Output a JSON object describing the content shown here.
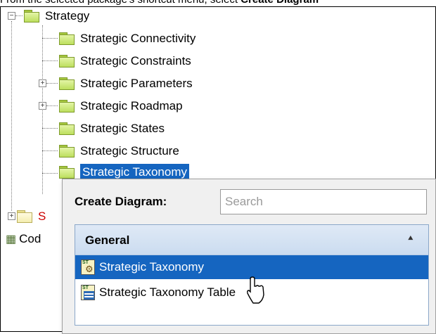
{
  "caption": {
    "text_before": "From the selected package's shortcut menu, select ",
    "text_bold": "Create Diagram"
  },
  "tree": {
    "root": {
      "label": "Strategy",
      "expander": "minus"
    },
    "items": [
      {
        "label": "Strategic Connectivity",
        "expander": ""
      },
      {
        "label": "Strategic Constraints",
        "expander": ""
      },
      {
        "label": "Strategic Parameters",
        "expander": "plus"
      },
      {
        "label": "Strategic Roadmap",
        "expander": "plus"
      },
      {
        "label": "Strategic States",
        "expander": ""
      },
      {
        "label": "Strategic Structure",
        "expander": ""
      },
      {
        "label": "Strategic Taxonomy",
        "expander": "",
        "selected": true
      }
    ],
    "partial_sibling": {
      "label": "S",
      "expander": "plus"
    },
    "code_item": {
      "label": "Cod",
      "icon": "code-engineering-icon"
    }
  },
  "popup": {
    "title": "Create Diagram:",
    "search_placeholder": "Search",
    "group": {
      "label": "General",
      "collapse_icon": "double-chevron-up-icon"
    },
    "items": [
      {
        "label": "Strategic Taxonomy",
        "icon": "strategic-taxonomy-diagram-icon",
        "active": true
      },
      {
        "label": "Strategic Taxonomy Table",
        "icon": "strategic-taxonomy-table-icon",
        "active": false
      }
    ]
  },
  "colors": {
    "selection": "#1565c0",
    "folder_green": "#bddf5e",
    "group_header": "#dfe9f6",
    "popup_bg": "#f0f0f0"
  }
}
